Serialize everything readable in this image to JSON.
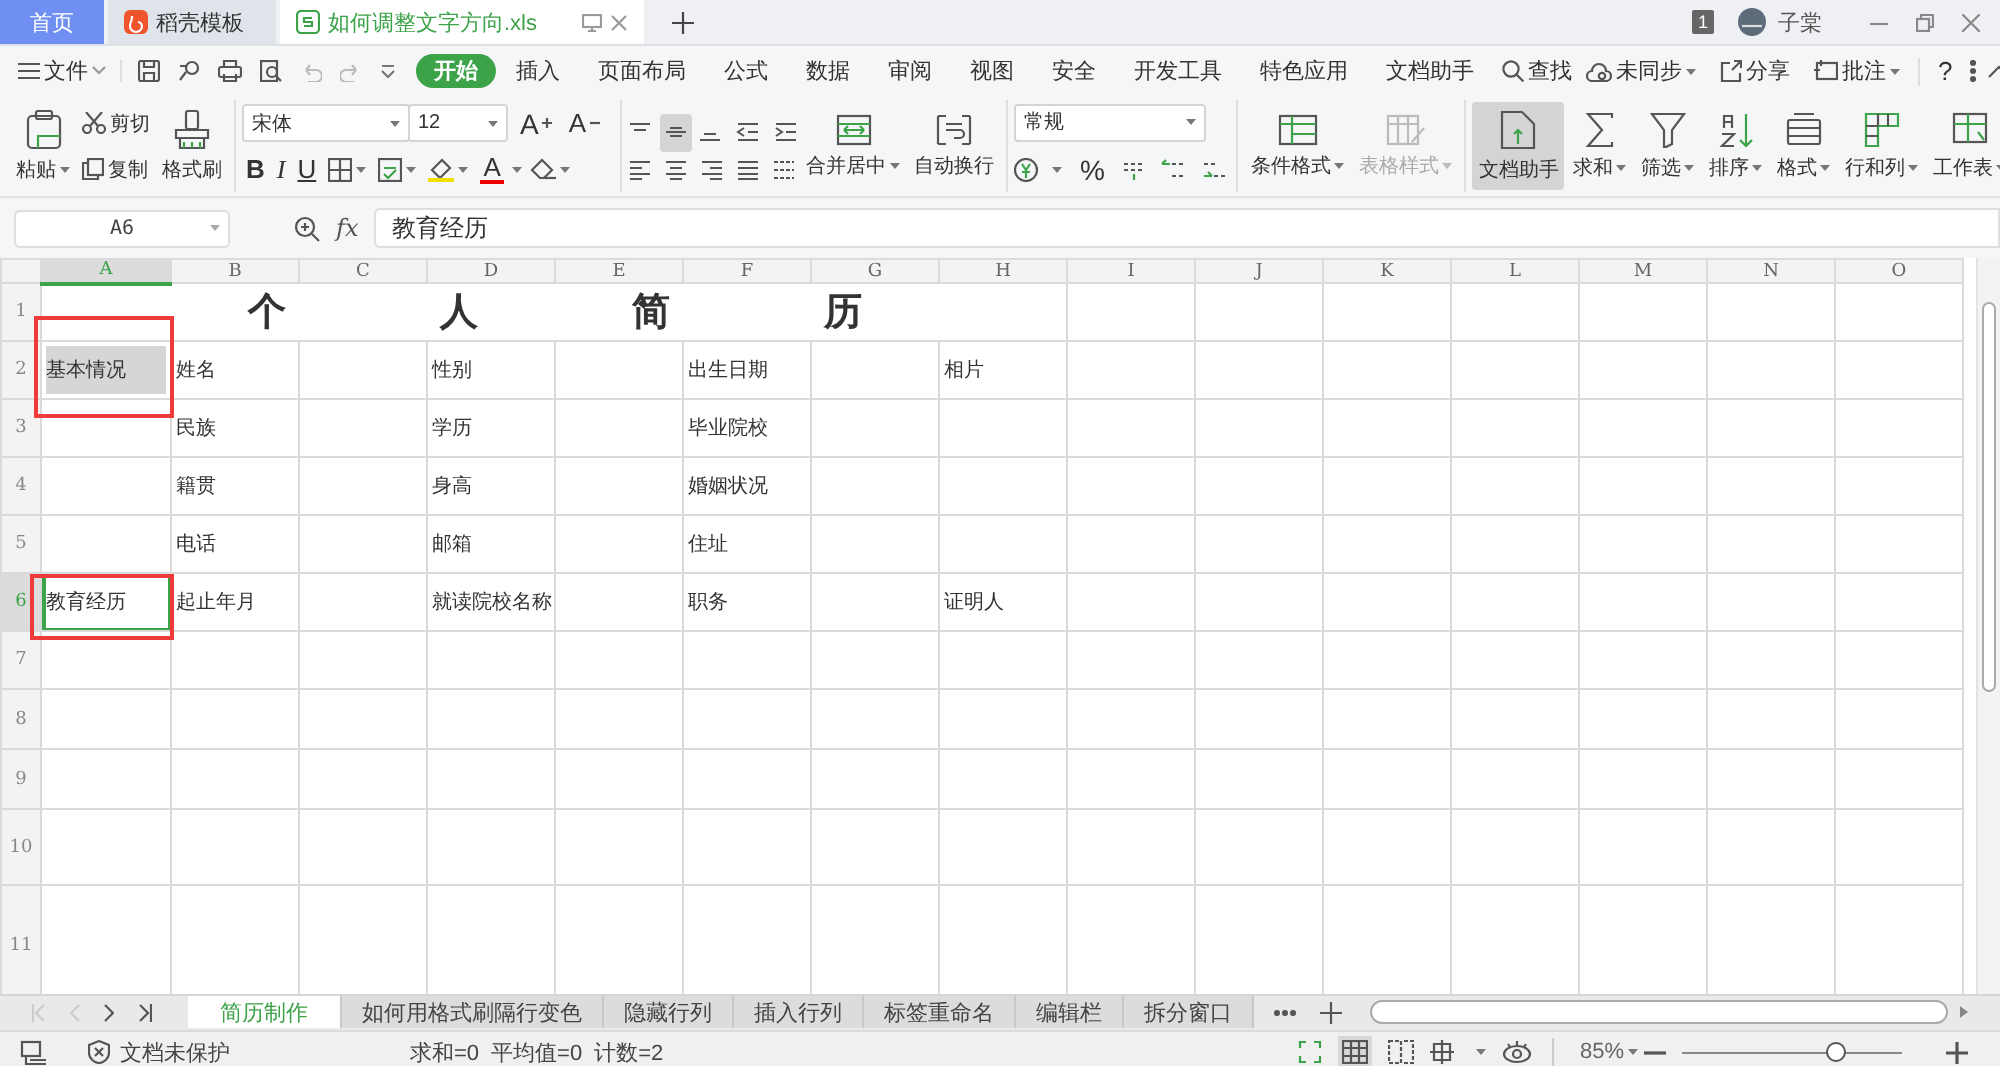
{
  "title_bar": {
    "tabs": [
      {
        "label": "首页",
        "kind": "home",
        "selected": false
      },
      {
        "label": "稻壳模板",
        "kind": "template",
        "selected": false
      },
      {
        "label": "如何调整文字方向.xls",
        "kind": "document",
        "selected": true
      }
    ],
    "badge": "1",
    "user": "子棠"
  },
  "menu_bar": {
    "file": "文件",
    "tabs": [
      {
        "label": "开始",
        "kind": "tab",
        "selected": true
      },
      {
        "label": "插入",
        "kind": "tab",
        "selected": false
      },
      {
        "label": "页面布局",
        "kind": "tab",
        "selected": false
      },
      {
        "label": "公式",
        "kind": "tab",
        "selected": false
      },
      {
        "label": "数据",
        "kind": "tab",
        "selected": false
      },
      {
        "label": "审阅",
        "kind": "tab",
        "selected": false
      },
      {
        "label": "视图",
        "kind": "tab",
        "selected": false
      },
      {
        "label": "安全",
        "kind": "tab",
        "selected": false
      },
      {
        "label": "开发工具",
        "kind": "tab",
        "selected": false
      },
      {
        "label": "特色应用",
        "kind": "tab",
        "selected": false
      },
      {
        "label": "文档助手",
        "kind": "tab",
        "selected": false
      },
      {
        "label": "查找",
        "kind": "search",
        "selected": false
      }
    ],
    "actions": [
      "未同步",
      "分享",
      "批注"
    ],
    "help": "?"
  },
  "ribbon": {
    "paste": "粘贴",
    "cut": "剪切",
    "copy": "复制",
    "format_painter": "格式刷",
    "font_name": "宋体",
    "font_size": "12",
    "grow_font": "A",
    "shrink_font": "A",
    "style_buttons": [
      "B",
      "I",
      "U"
    ],
    "font_color": "A",
    "alignment_buttons": [
      {
        "label": "合并居中",
        "dropdown": true,
        "disabled": false,
        "active": false
      },
      {
        "label": "自动换行",
        "dropdown": false,
        "disabled": false,
        "active": false
      }
    ],
    "number_format": "常规",
    "percent": "%",
    "style_buttons_large": [
      {
        "label": "条件格式",
        "dropdown": true,
        "disabled": false,
        "active": false
      },
      {
        "label": "表格样式",
        "dropdown": true,
        "disabled": true,
        "active": false
      }
    ],
    "tool_buttons": [
      {
        "label": "文档助手",
        "dropdown": false,
        "disabled": false,
        "active": true
      },
      {
        "label": "求和",
        "dropdown": true,
        "disabled": false,
        "active": false
      },
      {
        "label": "筛选",
        "dropdown": true,
        "disabled": false,
        "active": false
      },
      {
        "label": "排序",
        "dropdown": true,
        "disabled": false,
        "active": false
      },
      {
        "label": "格式",
        "dropdown": true,
        "disabled": false,
        "active": false
      },
      {
        "label": "行和列",
        "dropdown": true,
        "disabled": false,
        "active": false
      },
      {
        "label": "工作表",
        "dropdown": true,
        "disabled": false,
        "active": false
      }
    ]
  },
  "formula_bar": {
    "name_box": "A6",
    "function_label": "fx",
    "value": "教育经历"
  },
  "sheet": {
    "columns": [
      {
        "label": "A",
        "selected": true
      },
      {
        "label": "B",
        "selected": false
      },
      {
        "label": "C",
        "selected": false
      },
      {
        "label": "D",
        "selected": false
      },
      {
        "label": "E",
        "selected": false
      },
      {
        "label": "F",
        "selected": false
      },
      {
        "label": "G",
        "selected": false
      },
      {
        "label": "H",
        "selected": false
      },
      {
        "label": "I",
        "selected": false
      },
      {
        "label": "J",
        "selected": false
      },
      {
        "label": "K",
        "selected": false
      },
      {
        "label": "L",
        "selected": false
      },
      {
        "label": "M",
        "selected": false
      },
      {
        "label": "N",
        "selected": false
      },
      {
        "label": "O",
        "selected": false
      }
    ],
    "rows": [
      {
        "label": "1",
        "selected": false,
        "cells": [
          {
            "text": "个人简历",
            "kind": "title",
            "selected": false,
            "marked": false
          }
        ]
      },
      {
        "label": "2",
        "selected": false,
        "cells": [
          {
            "text": "基本情况",
            "kind": "filled",
            "selected": false,
            "marked": true
          },
          {
            "text": "姓名",
            "kind": "text",
            "selected": false,
            "marked": false
          },
          {
            "kind": "empty",
            "selected": false,
            "marked": false
          },
          {
            "text": "性别",
            "kind": "text",
            "selected": false,
            "marked": false
          },
          {
            "kind": "empty",
            "selected": false,
            "marked": false
          },
          {
            "text": "出生日期",
            "kind": "text",
            "selected": false,
            "marked": false
          },
          {
            "kind": "empty",
            "selected": false,
            "marked": false
          },
          {
            "text": "相片",
            "kind": "text",
            "selected": false,
            "marked": false
          }
        ]
      },
      {
        "label": "3",
        "selected": false,
        "cells": [
          {
            "kind": "empty",
            "selected": false,
            "marked": false
          },
          {
            "text": "民族",
            "kind": "text",
            "selected": false,
            "marked": false
          },
          {
            "kind": "empty",
            "selected": false,
            "marked": false
          },
          {
            "text": "学历",
            "kind": "text",
            "selected": false,
            "marked": false
          },
          {
            "kind": "empty",
            "selected": false,
            "marked": false
          },
          {
            "text": "毕业院校",
            "kind": "text",
            "selected": false,
            "marked": false
          }
        ]
      },
      {
        "label": "4",
        "selected": false,
        "cells": [
          {
            "kind": "empty",
            "selected": false,
            "marked": false
          },
          {
            "text": "籍贯",
            "kind": "text",
            "selected": false,
            "marked": false
          },
          {
            "kind": "empty",
            "selected": false,
            "marked": false
          },
          {
            "text": "身高",
            "kind": "text",
            "selected": false,
            "marked": false
          },
          {
            "kind": "empty",
            "selected": false,
            "marked": false
          },
          {
            "text": "婚姻状况",
            "kind": "text",
            "selected": false,
            "marked": false
          }
        ]
      },
      {
        "label": "5",
        "selected": false,
        "cells": [
          {
            "kind": "empty",
            "selected": false,
            "marked": false
          },
          {
            "text": "电话",
            "kind": "text",
            "selected": false,
            "marked": false
          },
          {
            "kind": "empty",
            "selected": false,
            "marked": false
          },
          {
            "text": "邮箱",
            "kind": "text",
            "selected": false,
            "marked": false
          },
          {
            "kind": "empty",
            "selected": false,
            "marked": false
          },
          {
            "text": "住址",
            "kind": "text",
            "selected": false,
            "marked": false
          }
        ]
      },
      {
        "label": "6",
        "selected": true,
        "cells": [
          {
            "text": "教育经历",
            "kind": "text",
            "selected": true,
            "marked": true
          },
          {
            "text": "起止年月",
            "kind": "text",
            "selected": false,
            "marked": false
          },
          {
            "kind": "empty",
            "selected": false,
            "marked": false
          },
          {
            "text": "就读院校名称",
            "kind": "text",
            "selected": false,
            "marked": false
          },
          {
            "kind": "empty",
            "selected": false,
            "marked": false
          },
          {
            "text": "职务",
            "kind": "text",
            "selected": false,
            "marked": false
          },
          {
            "kind": "empty",
            "selected": false,
            "marked": false
          },
          {
            "text": "证明人",
            "kind": "text",
            "selected": false,
            "marked": false
          }
        ]
      },
      {
        "label": "7",
        "selected": false
      },
      {
        "label": "8",
        "selected": false
      },
      {
        "label": "9",
        "selected": false
      },
      {
        "label": "10",
        "selected": false
      },
      {
        "label": "11",
        "selected": false
      }
    ]
  },
  "sheet_tabs": [
    {
      "label": "简历制作",
      "selected": true
    },
    {
      "label": "如何用格式刷隔行变色",
      "selected": false
    },
    {
      "label": "隐藏行列",
      "selected": false
    },
    {
      "label": "插入行列",
      "selected": false
    },
    {
      "label": "标签重命名",
      "selected": false
    },
    {
      "label": "编辑栏",
      "selected": false
    },
    {
      "label": "拆分窗口",
      "selected": false
    }
  ],
  "status_bar": {
    "protection": "文档未保护",
    "stats": [
      "求和=0",
      "平均值=0",
      "计数=2"
    ],
    "zoom": "85%",
    "zoom_slider": {
      "level": 0.7
    }
  }
}
